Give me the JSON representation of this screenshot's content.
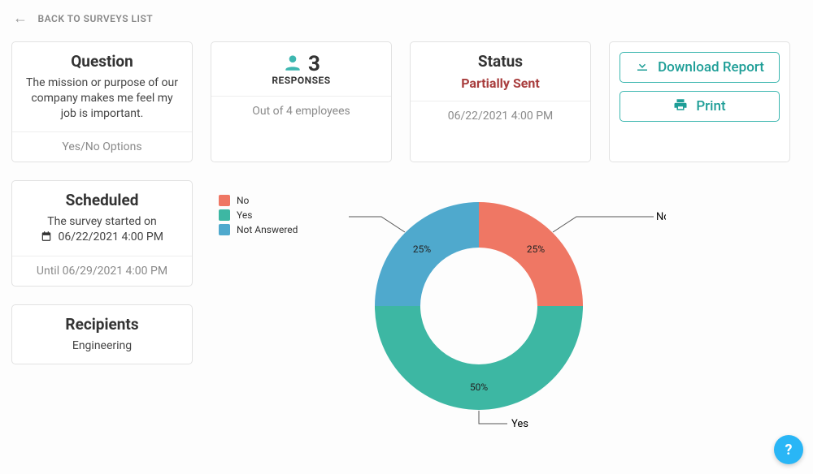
{
  "nav": {
    "back_label": "BACK TO SURVEYS LIST"
  },
  "question": {
    "heading": "Question",
    "text": "The mission or purpose of our company makes me feel my job is important.",
    "footer": "Yes/No Options"
  },
  "responses": {
    "count": "3",
    "label": "RESPONSES",
    "footer": "Out of 4 employees"
  },
  "status": {
    "heading": "Status",
    "value": "Partially Sent",
    "footer": "06/22/2021 4:00 PM"
  },
  "actions": {
    "download": "Download Report",
    "print": "Print"
  },
  "scheduled": {
    "heading": "Scheduled",
    "started_on": "The survey started on",
    "start_date": "06/22/2021 4:00 PM",
    "footer": "Until 06/29/2021 4:00 PM"
  },
  "recipients": {
    "heading": "Recipients",
    "value": "Engineering"
  },
  "chart_data": {
    "type": "pie",
    "title": "",
    "series": [
      {
        "name": "No",
        "value": 25,
        "color": "#ef7764"
      },
      {
        "name": "Yes",
        "value": 50,
        "color": "#3db7a3"
      },
      {
        "name": "Not Answered",
        "value": 25,
        "color": "#4fa9cd"
      }
    ],
    "pct_labels": {
      "No": "25%",
      "Yes": "50%",
      "Not Answered": "25%"
    },
    "legend_order": [
      "No",
      "Yes",
      "Not Answered"
    ]
  },
  "help": {
    "label": "?"
  }
}
